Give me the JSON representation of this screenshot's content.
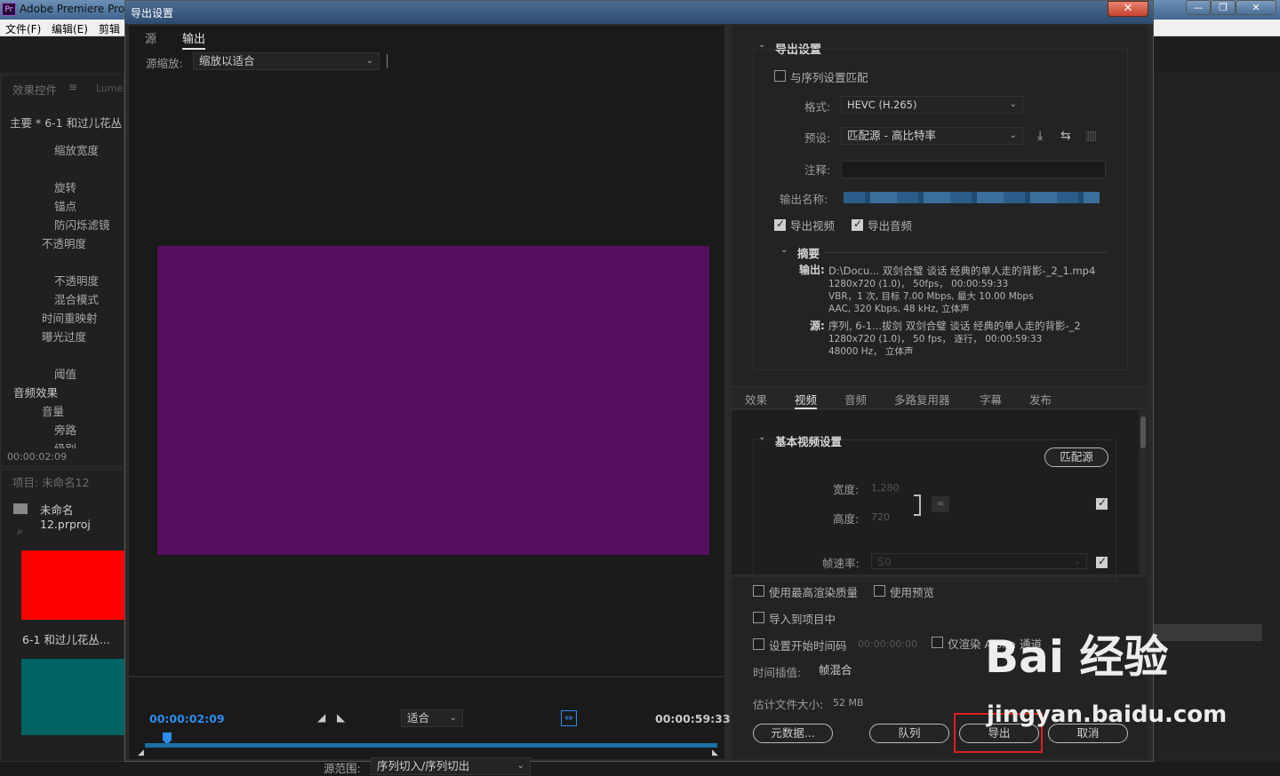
{
  "app": {
    "title": "Adobe Premiere Pro",
    "logo": "Pr",
    "menu": [
      "文件(F)",
      "编辑(E)",
      "剪辑"
    ],
    "win_buttons": [
      "—",
      "❐",
      "✕"
    ],
    "left_panel": {
      "tabs": [
        "效果控件",
        "Lume"
      ],
      "clip_title": "主要 * 6-1  和过儿花丛",
      "rows": [
        "缩放宽度",
        "旋转",
        "锚点",
        "防闪烁滤镜",
        "不透明度",
        "不透明度",
        "混合模式",
        "时间重映射",
        "曝光过度",
        "阈值",
        "音频效果",
        "音量",
        "旁路",
        "级别"
      ],
      "time": "00:00:02:09"
    },
    "project_panel": {
      "title": "项目: 未命名12",
      "file": "未命名12.prproj",
      "clip_label": "6-1  和过儿花丛..."
    }
  },
  "dialog": {
    "title": "导出设置",
    "close_icon": "✕",
    "tabs": [
      "源",
      "输出"
    ],
    "source_scale_label": "源缩放:",
    "source_scale_value": "缩放以适合",
    "timecode_start": "00:00:02:09",
    "timecode_end": "00:00:59:33",
    "fit_value": "适合",
    "source_range_label": "源范围:",
    "source_range_value": "序列切入/序列切出",
    "preview_color": "#560e5e",
    "export_settings": {
      "header": "导出设置",
      "match_sequence": "与序列设置匹配",
      "format_label": "格式:",
      "format_value": "HEVC (H.265)",
      "preset_label": "预设:",
      "preset_value": "匹配源 - 高比特率",
      "comment_label": "注释:",
      "output_name_label": "输出名称:",
      "export_video": "导出视频",
      "export_audio": "导出音频",
      "summary_header": "摘要",
      "output_label": "输出:",
      "output_lines": [
        "D:\\Docu... 双剑合璧 谈话 经典的单人走的背影-_2_1.mp4",
        "1280x720 (1.0)， 50fps， 00:00:59:33",
        "VBR，1 次, 目标 7.00 Mbps, 最大 10.00 Mbps",
        "AAC, 320 Kbps, 48  kHz, 立体声"
      ],
      "source_label": "源:",
      "source_lines": [
        "序列, 6-1...拔剑 双剑合璧 谈话 经典的单人走的背影-_2",
        "1280x720 (1.0)， 50 fps， 逐行， 00:00:59:33",
        "48000 Hz， 立体声"
      ]
    },
    "settings_tabs": [
      "效果",
      "视频",
      "音频",
      "多路复用器",
      "字幕",
      "发布"
    ],
    "video": {
      "header": "基本视频设置",
      "match_source": "匹配源",
      "width_label": "宽度:",
      "width_value": "1,280",
      "height_label": "高度:",
      "height_value": "720",
      "fps_label": "帧速率:",
      "fps_value": "50"
    },
    "bottom": {
      "max_render": "使用最高渲染质量",
      "use_preview": "使用预览",
      "import_project": "导入到项目中",
      "set_timecode": "设置开始时间码",
      "timecode_value": "00:00:00:00",
      "alpha_only": "仅渲染 Alpha 通道",
      "interp_label": "时间插值:",
      "interp_value": "帧混合",
      "filesize_label": "估计文件大小:",
      "filesize_value": "52 MB",
      "metadata_btn": "元数据...",
      "queue_btn": "队列",
      "export_btn": "导出",
      "cancel_btn": "取消"
    }
  },
  "watermark": {
    "line1": "Bai 经验",
    "line2": "jingyan.baidu.com"
  }
}
